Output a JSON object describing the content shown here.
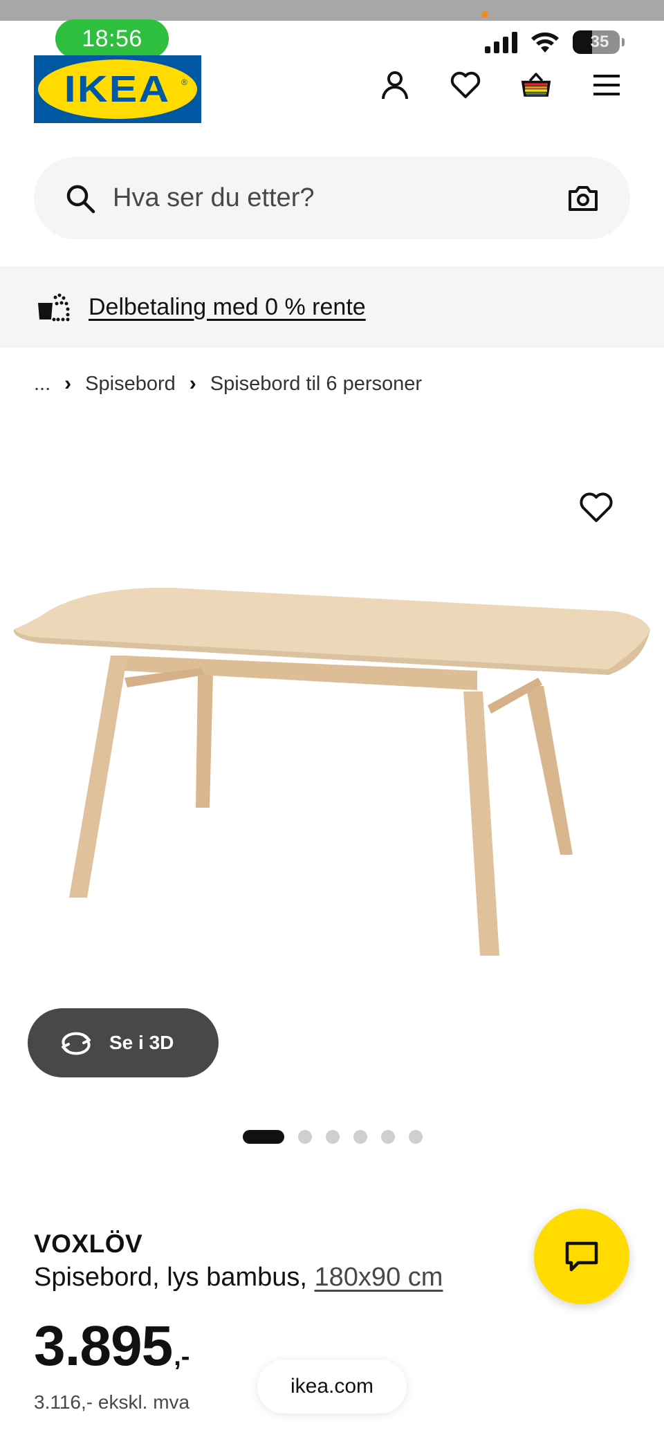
{
  "status_bar": {
    "time": "18:56",
    "battery": "35"
  },
  "header": {
    "logo_text": "IKEA",
    "logo_reg": "®",
    "icons": [
      "profile-icon",
      "heart-icon",
      "cart-icon",
      "menu-icon"
    ]
  },
  "search": {
    "placeholder": "Hva ser du etter?",
    "icons": [
      "search-icon",
      "camera-icon"
    ]
  },
  "promo": {
    "text": "Delbetaling med 0 % rente"
  },
  "breadcrumb": {
    "ellipsis": "...",
    "separator": "›",
    "items": [
      "Spisebord",
      "Spisebord til 6 personer"
    ]
  },
  "gallery": {
    "see_3d_label": "Se i 3D",
    "image_count": 6,
    "active_index": 0
  },
  "product": {
    "name": "VOXLÖV",
    "description": "Spisebord, lys bambus, ",
    "size_link": "180x90 cm",
    "price": "3.895",
    "price_suffix": ",-",
    "price_excl_vat": "3.116,- ekskl. mva"
  },
  "browser": {
    "url": "ikea.com"
  },
  "colors": {
    "ikea_blue": "#0058a3",
    "ikea_yellow": "#ffdb00",
    "time_pill_green": "#2fbf3f",
    "see3d_bg": "#484848",
    "promo_bg": "#f5f5f5"
  }
}
